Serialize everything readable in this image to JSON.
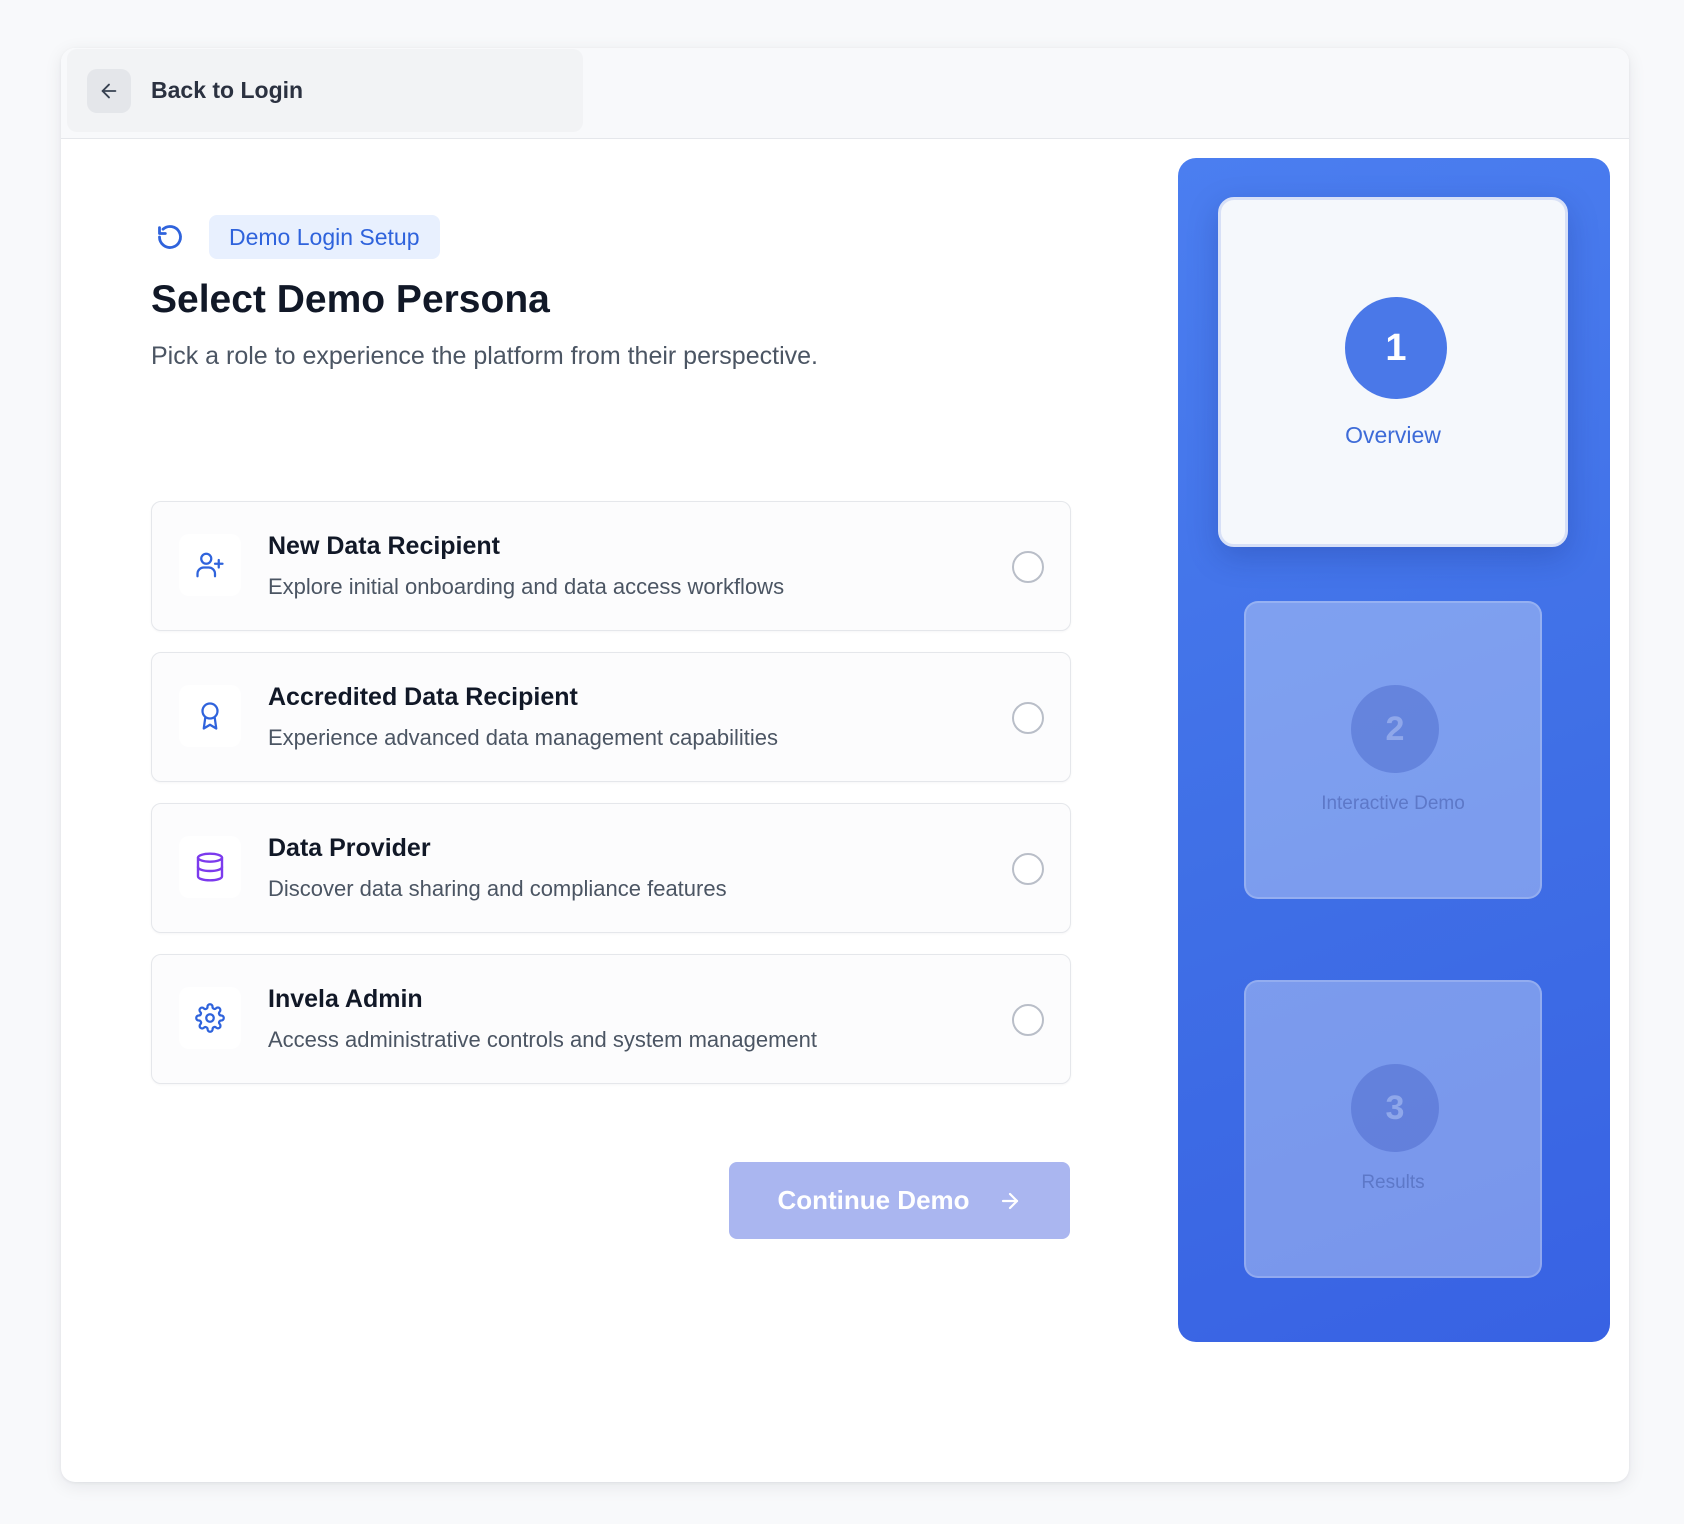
{
  "header": {
    "back_label": "Back to Login",
    "back_icon": "arrow-left-icon"
  },
  "intro": {
    "badge_icon": "loader-icon",
    "badge": "Demo Login Setup",
    "title": "Select Demo Persona",
    "subtitle": "Pick a role to experience the platform from their perspective."
  },
  "personas": [
    {
      "icon": "user-plus-icon",
      "name": "New Data Recipient",
      "description": "Explore initial onboarding and data access workflows",
      "selected": false
    },
    {
      "icon": "award-icon",
      "name": "Accredited Data Recipient",
      "description": "Experience advanced data management capabilities",
      "selected": false
    },
    {
      "icon": "database-icon",
      "name": "Data Provider",
      "description": "Discover data sharing and compliance features",
      "selected": false
    },
    {
      "icon": "settings-icon",
      "name": "Invela Admin",
      "description": "Access administrative controls and system management",
      "selected": false
    }
  ],
  "continue": {
    "label": "Continue Demo",
    "icon": "arrow-right-icon",
    "disabled": true
  },
  "steps": [
    {
      "number": "1",
      "label": "Overview",
      "active": true
    },
    {
      "number": "2",
      "label": "Interactive Demo",
      "active": false
    },
    {
      "number": "3",
      "label": "Results",
      "active": false
    }
  ],
  "colors": {
    "accent": "#2f63dc",
    "panel": "#4574ea",
    "button_disabled": "#aab6f0",
    "database_icon": "#7c3aed"
  }
}
